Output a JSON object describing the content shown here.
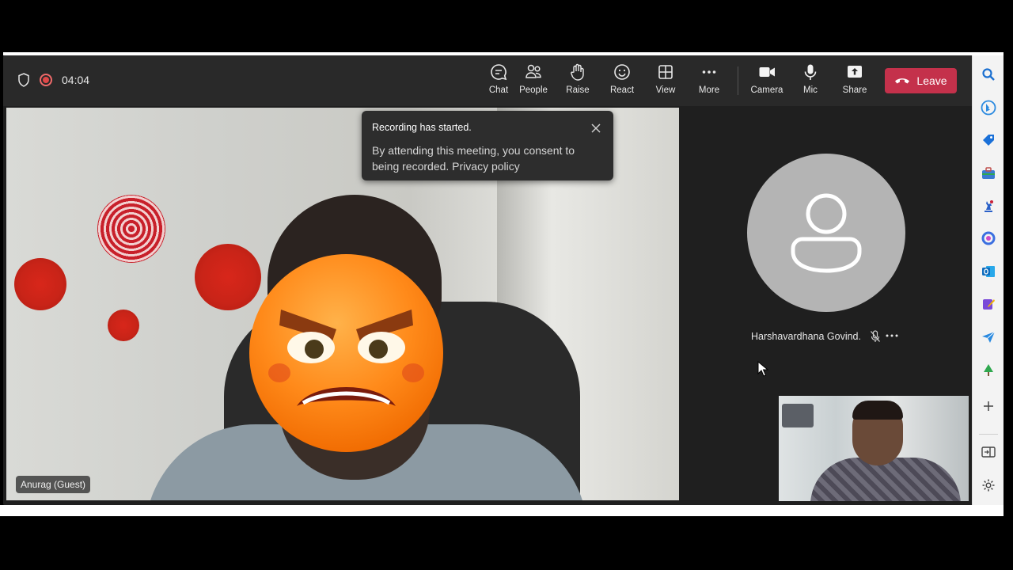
{
  "topbar": {
    "timer": "04:04",
    "buttons": [
      {
        "label": "Chat",
        "icon": "chat-icon"
      },
      {
        "label": "People",
        "icon": "people-icon"
      },
      {
        "label": "Raise",
        "icon": "raise-hand-icon"
      },
      {
        "label": "React",
        "icon": "react-smiley-icon"
      },
      {
        "label": "View",
        "icon": "view-grid-icon"
      },
      {
        "label": "More",
        "icon": "more-dots-icon"
      },
      {
        "label": "Camera",
        "icon": "camera-icon"
      },
      {
        "label": "Mic",
        "icon": "mic-icon"
      },
      {
        "label": "Share",
        "icon": "share-icon"
      }
    ],
    "leave_label": "Leave",
    "leave_color": "#c4314b"
  },
  "toast": {
    "title": "Recording has started.",
    "body": "By attending this meeting, you consent to being recorded. Privacy policy"
  },
  "main_video": {
    "participant_label": "Anurag (Guest)"
  },
  "participant": {
    "name": "Harshavardhana Govind..."
  },
  "rail": {
    "icons": [
      "search-icon",
      "bing-icon",
      "tag-icon",
      "briefcase-icon",
      "chess-icon",
      "copilot-icon",
      "outlook-icon",
      "designer-icon",
      "send-icon",
      "tree-icon",
      "add-icon",
      "sidebar-toggle-icon",
      "settings-icon"
    ]
  }
}
